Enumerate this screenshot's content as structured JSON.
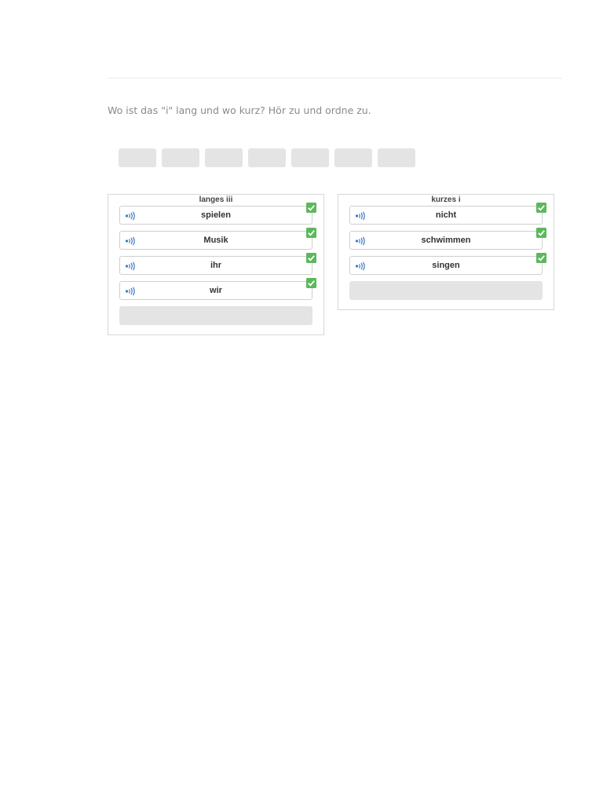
{
  "instruction": "Wo ist das \"i\" lang und wo kurz? Hör zu und ordne zu.",
  "colors": {
    "check": "#5cb85c",
    "audio": "#3a78c9",
    "slot": "#e4e4e4",
    "border": "#d6d6d6"
  },
  "groups": [
    {
      "title": "langes iii",
      "items": [
        {
          "word": "spielen",
          "icon": "audio-icon",
          "status": "check-icon"
        },
        {
          "word": "Musik",
          "icon": "audio-icon",
          "status": "check-icon"
        },
        {
          "word": "ihr",
          "icon": "audio-icon",
          "status": "check-icon"
        },
        {
          "word": "wir",
          "icon": "audio-icon",
          "status": "check-icon"
        }
      ]
    },
    {
      "title": "kurzes i",
      "items": [
        {
          "word": "nicht",
          "icon": "audio-icon",
          "status": "check-icon"
        },
        {
          "word": "schwimmen",
          "icon": "audio-icon",
          "status": "check-icon"
        },
        {
          "word": "singen",
          "icon": "audio-icon",
          "status": "check-icon"
        }
      ]
    }
  ]
}
